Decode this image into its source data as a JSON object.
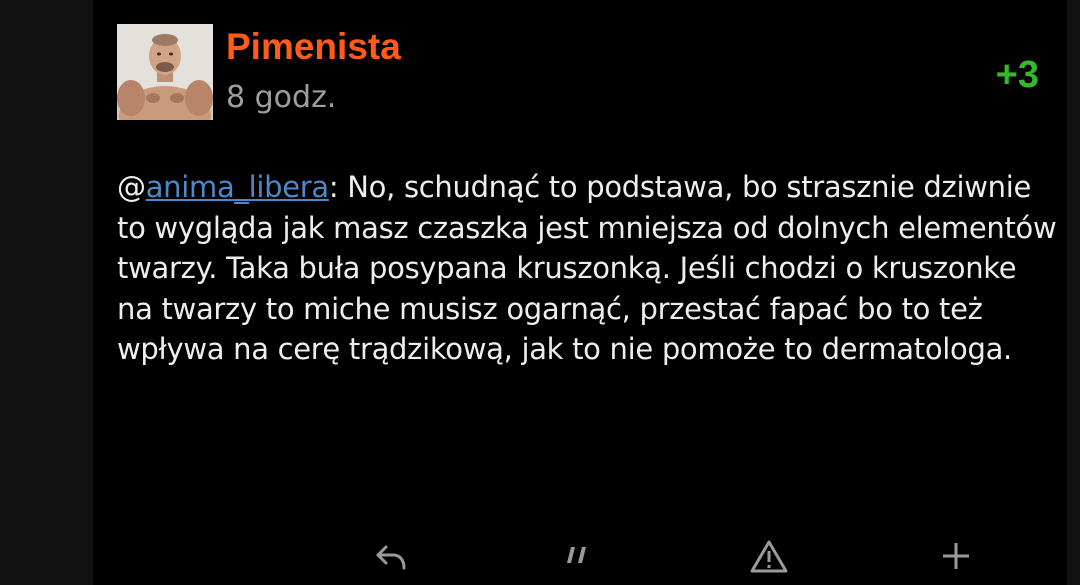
{
  "comment": {
    "author": "Pimenista",
    "time": "8 godz.",
    "score": "+3",
    "mention_prefix": "@",
    "mention_user": "anima_libera",
    "text": ": No, schudnąć to podstawa, bo strasznie dziwnie to wygląda jak masz czaszka jest mniejsza od dolnych elementów twarzy. Taka buła posypana kruszonką. Jeśli chodzi o kruszonke na twarzy to miche musisz ogarnąć, przestać fapać bo to też wpływa na cerę trądzikową, jak to nie pomoże to dermatologa."
  },
  "actions": {
    "reply_icon": "reply-icon",
    "quote_icon": "quote-icon",
    "report_icon": "warning-icon",
    "plus_icon": "plus-icon"
  },
  "colors": {
    "username": "#ff5c19",
    "score": "#35b82b",
    "mention": "#4d88c9",
    "background": "#000000"
  }
}
